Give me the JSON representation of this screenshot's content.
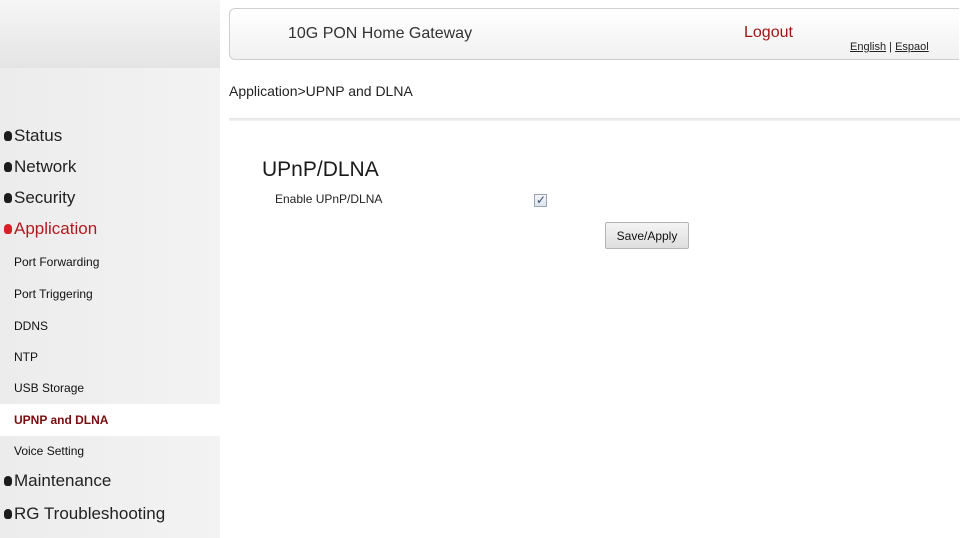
{
  "header": {
    "title": "10G PON Home Gateway",
    "logout_label": "Logout",
    "lang_english": "English",
    "lang_separator": " | ",
    "lang_spanish": "Espaol"
  },
  "breadcrumb": "Application>UPNP and DLNA",
  "sidebar": {
    "groups": [
      {
        "label": "Status"
      },
      {
        "label": "Network"
      },
      {
        "label": "Security"
      },
      {
        "label": "Application",
        "active": true
      },
      {
        "label": "Maintenance"
      },
      {
        "label": "RG Troubleshooting"
      }
    ],
    "application_items": [
      {
        "label": "Port Forwarding"
      },
      {
        "label": "Port Triggering"
      },
      {
        "label": "DDNS"
      },
      {
        "label": "NTP"
      },
      {
        "label": "USB Storage"
      },
      {
        "label": "UPNP and DLNA",
        "selected": true
      },
      {
        "label": "Voice Setting"
      }
    ]
  },
  "main": {
    "section_title": "UPnP/DLNA",
    "enable_label": "Enable UPnP/DLNA",
    "enable_checked": true,
    "checkmark": "✓",
    "save_label": "Save/Apply"
  },
  "colors": {
    "active_menu": "#b21a1f",
    "selected_item": "#7a0c0f",
    "logout": "#a01414"
  }
}
